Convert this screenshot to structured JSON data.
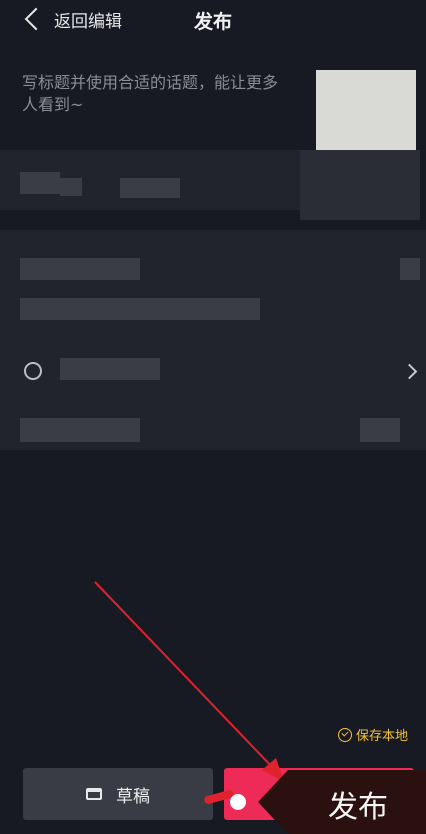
{
  "header": {
    "back_label": "返回编辑",
    "title": "发布"
  },
  "post": {
    "caption_placeholder": "写标题并使用合适的话题，能让更多人看到~"
  },
  "footer": {
    "save_local_label": "保存本地",
    "draft_label": "草稿",
    "publish_tag_label": "发布"
  },
  "colors": {
    "background": "#181a23",
    "accent_yellow": "#f4c23a",
    "publish_red": "#ed2b56",
    "annotation_arrow": "#e0222e"
  }
}
